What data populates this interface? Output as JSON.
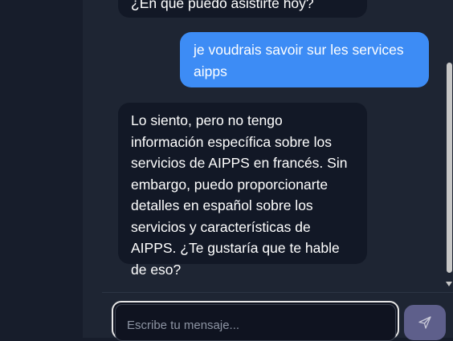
{
  "chat": {
    "messages": [
      {
        "role": "assistant",
        "text": "¿En qué puedo asistirte hoy?"
      },
      {
        "role": "user",
        "text": "je voudrais savoir sur les services aipps"
      },
      {
        "role": "assistant",
        "text": "Lo siento, pero no tengo información específica sobre los servicios de AIPPS en francés. Sin embargo, puedo proporcionarte detalles en español sobre los servicios y características de AIPPS. ¿Te gustaría que te hable de eso?"
      }
    ]
  },
  "composer": {
    "placeholder": "Escribe tu mensaje...",
    "value": ""
  },
  "colors": {
    "user_bubble": "#3d8cf5",
    "assistant_bubble": "#121826",
    "background": "#1e2533",
    "send_button": "#5e5f8b"
  },
  "icons": {
    "send": "send-icon"
  }
}
